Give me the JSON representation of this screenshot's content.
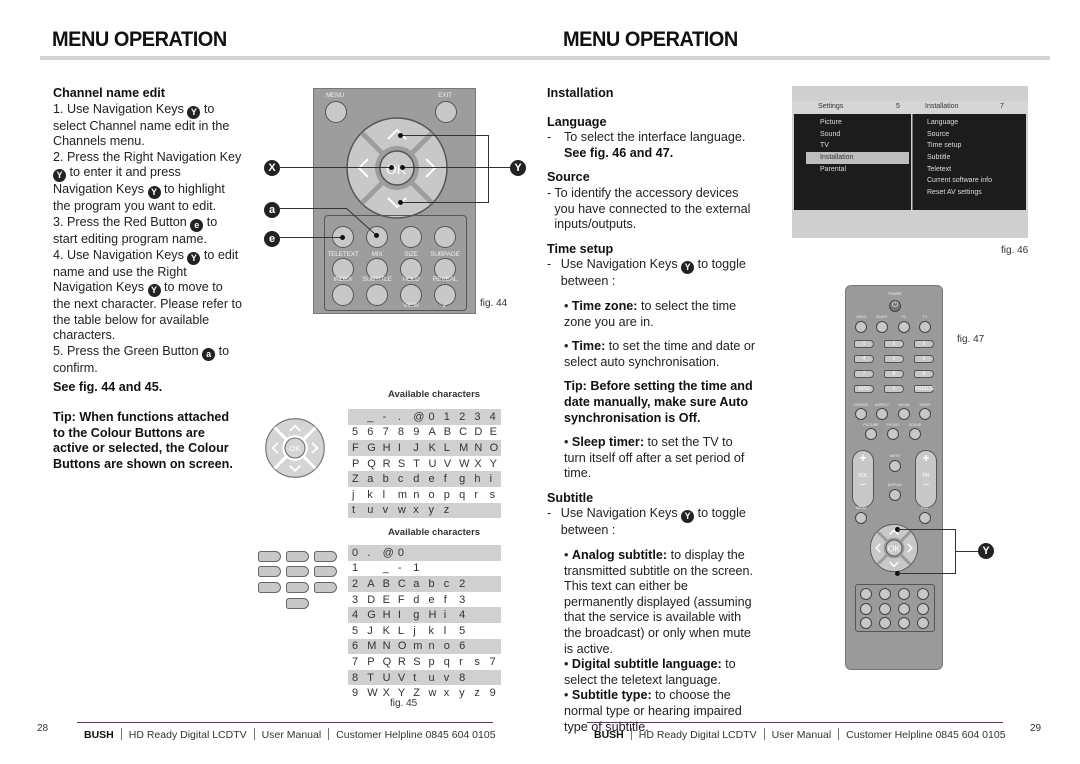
{
  "header": {
    "left_title": "MENU OPERATION",
    "right_title": "MENU OPERATION"
  },
  "left_column": {
    "heading": "Channel name edit",
    "steps": [
      {
        "pre": "1. Use Navigation Keys ",
        "icon": "Y",
        "post": " to select Channel name edit in the Channels menu."
      },
      {
        "pre": "2. Press the Right Navigation Key ",
        "icon": "Y",
        "mid": " to enter it and press Navigation Keys ",
        "icon2": "Y",
        "post": " to highlight the program you want to edit."
      },
      {
        "pre": "3. Press the Red Button ",
        "icon": "e",
        "post": " to start editing program name."
      },
      {
        "pre": "4. Use Navigation Keys ",
        "icon": "Y",
        "mid": " to edit name and use the Right Navigation Keys ",
        "icon2": "Y",
        "post": " to move to the next character. Please refer to the table below for available characters."
      },
      {
        "pre": "5. Press the Green Button ",
        "icon": "a",
        "post": " to confirm."
      }
    ],
    "see_fig": "See fig. 44 and 45.",
    "tip": "Tip: When functions attached to the Colour Buttons are active or selected, the Colour Buttons are shown on screen."
  },
  "fig44": {
    "caption": "fig. 44",
    "callouts": {
      "x": "X",
      "y": "Y",
      "a": "a",
      "e": "e"
    },
    "top_buttons": [
      "MENU",
      "EXIT"
    ],
    "center_button": "OK",
    "row1_labels": [
      "TELETEXT",
      "MIX",
      "SIZE",
      "SUBPAGE"
    ],
    "row2_labels": [
      "INDEX",
      "SUBTITLE",
      "HOLD",
      "REVEAL"
    ],
    "bottom_labels": [
      "VIEW",
      "✓"
    ]
  },
  "fig45": {
    "caption": "fig. 45",
    "table1_title": "Available characters",
    "table1_rows": [
      [
        "",
        "_",
        "-",
        ".",
        "@",
        "0",
        "1",
        "2",
        "3",
        "4"
      ],
      [
        "5",
        "6",
        "7",
        "8",
        "9",
        "A",
        "B",
        "C",
        "D",
        "E"
      ],
      [
        "F",
        "G",
        "H",
        "I",
        "J",
        "K",
        "L",
        "M",
        "N",
        "O"
      ],
      [
        "P",
        "Q",
        "R",
        "S",
        "T",
        "U",
        "V",
        "W",
        "X",
        "Y"
      ],
      [
        "Z",
        "a",
        "b",
        "c",
        "d",
        "e",
        "f",
        "g",
        "h",
        "i"
      ],
      [
        "j",
        "k",
        "l",
        "m",
        "n",
        "o",
        "p",
        "q",
        "r",
        "s"
      ],
      [
        "t",
        "u",
        "v",
        "w",
        "x",
        "y",
        "z",
        "",
        "",
        ""
      ]
    ],
    "nav_center": "OK",
    "table2_title": "Available characters",
    "keypad": [
      "1",
      "2",
      "3",
      "4",
      "5",
      "6",
      "7",
      "8",
      "9",
      "0"
    ],
    "table2_rows": [
      [
        "0",
        ".",
        "@",
        "0",
        "",
        "",
        "",
        "",
        "",
        ""
      ],
      [
        "1",
        "",
        "_",
        "-",
        "1",
        "",
        "",
        "",
        "",
        ""
      ],
      [
        "2",
        "A",
        "B",
        "C",
        "a",
        "b",
        "c",
        "2",
        "",
        ""
      ],
      [
        "3",
        "D",
        "E",
        "F",
        "d",
        "e",
        "f",
        "3",
        "",
        ""
      ],
      [
        "4",
        "G",
        "H",
        "I",
        "g",
        "H",
        "i",
        "4",
        "",
        ""
      ],
      [
        "5",
        "J",
        "K",
        "L",
        "j",
        "k",
        "l",
        "5",
        "",
        ""
      ],
      [
        "6",
        "M",
        "N",
        "O",
        "m",
        "n",
        "o",
        "6",
        "",
        ""
      ],
      [
        "7",
        "P",
        "Q",
        "R",
        "S",
        "p",
        "q",
        "r",
        "s",
        "7"
      ],
      [
        "8",
        "T",
        "U",
        "V",
        "t",
        "u",
        "v",
        "8",
        "",
        ""
      ],
      [
        "9",
        "W",
        "X",
        "Y",
        "Z",
        "w",
        "x",
        "y",
        "z",
        "9"
      ]
    ]
  },
  "right_column": {
    "heading": "Installation",
    "language": {
      "title": "Language",
      "text": "To select the interface language.",
      "see": "See fig. 46 and 47."
    },
    "source": {
      "title": "Source",
      "text": "To identify the accessory devices you have connected to the external inputs/outputs."
    },
    "time_setup": {
      "title": "Time setup",
      "intro_pre": "Use Navigation Keys ",
      "intro_icon": "Y",
      "intro_post": " to toggle between :",
      "time_zone_label": "Time zone:",
      "time_zone_text": " to select the time zone you are in.",
      "time_label": "Time:",
      "time_text": " to set the time and date or select auto synchronisation.",
      "tip": "Tip: Before setting the time and date manually, make sure Auto synchronisation is Off.",
      "sleep_label": "Sleep timer:",
      "sleep_text": " to set the TV to turn itself off after a set period of time."
    },
    "subtitle": {
      "title": "Subtitle",
      "intro_pre": "Use Navigation Keys ",
      "intro_icon": "Y",
      "intro_post": " to toggle between :",
      "analog_label": "Analog subtitle:",
      "analog_text": " to display the transmitted subtitle on the screen. This text can either be permanently displayed (assuming that the service is available with the broadcast) or only when mute is active.",
      "digital_label": "Digital subtitle language:",
      "digital_text": " to select the teletext language.",
      "type_label": "Subtitle type:",
      "type_text": " to choose the normal type or hearing impaired type of subtitle."
    }
  },
  "fig46": {
    "caption": "fig. 46",
    "left_header": "Settings",
    "left_count": "5",
    "right_header": "Installation",
    "right_count": "7",
    "left_items": [
      "Picture",
      "Sound",
      "TV",
      "Installation",
      "Parental"
    ],
    "selected": "Installation",
    "right_items": [
      "Language",
      "Source",
      "Time setup",
      "Subtitle",
      "Teletext",
      "Current software info",
      "Reset AV settings"
    ]
  },
  "fig47": {
    "caption": "fig. 47",
    "callout": "Y",
    "power": "POWER",
    "source_row": [
      "VIDEO",
      "SCART",
      "PC",
      "TV"
    ],
    "numbers": [
      "1",
      "2",
      "3",
      "4",
      "5",
      "6",
      "7",
      "8",
      "9",
      "EPG",
      "0",
      "FREEZE"
    ],
    "func_row": [
      "SOURCE",
      "ASPECT",
      "NICAM",
      "SLEEP"
    ],
    "func_row2": [
      "PICTURE",
      "PR LIST",
      "SOUND"
    ],
    "vol": "VOL",
    "pr": "PR",
    "mute": "MUTE",
    "display": "DISPLAY",
    "menu": "MENU",
    "exit": "EXIT",
    "ok": "OK"
  },
  "footer": {
    "left_page": "28",
    "right_page": "29",
    "brand": "BUSH",
    "product": "HD Ready Digital LCDTV",
    "doc": "User Manual",
    "helpline": "Customer Helpline 0845 604 0105"
  },
  "colors": {
    "footer_rule": "#5a3a55",
    "title_bar": "#d4d4d4",
    "menu_panel": "#1c1c1c",
    "remote_body": "#9d9d9d"
  }
}
